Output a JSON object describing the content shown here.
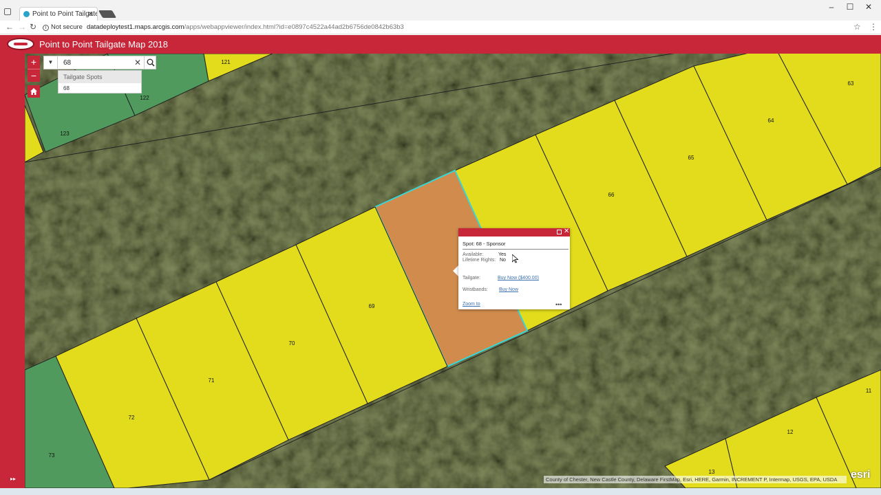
{
  "browser": {
    "tab_title": "Point to Point Tailgate M",
    "security_label": "Not secure",
    "url_host": "datadeploytest1.maps.arcgis.com",
    "url_path": "/apps/webappviewer/index.html?id=e0897c4522a44ad2b6756de0842b63b3"
  },
  "app": {
    "title": "Point to Point Tailgate Map 2018",
    "accent_color": "#c8273a"
  },
  "search": {
    "value": "68",
    "suggestions_header": "Tailgate Spots",
    "suggestions": [
      "68"
    ]
  },
  "map": {
    "parcels": [
      {
        "label": "121",
        "status": "yellow"
      },
      {
        "label": "122",
        "status": "green"
      },
      {
        "label": "123",
        "status": "green"
      },
      {
        "label": "63",
        "status": "yellow"
      },
      {
        "label": "64",
        "status": "yellow"
      },
      {
        "label": "65",
        "status": "yellow"
      },
      {
        "label": "66",
        "status": "yellow"
      },
      {
        "label": "68",
        "status": "selected"
      },
      {
        "label": "69",
        "status": "yellow"
      },
      {
        "label": "70",
        "status": "yellow"
      },
      {
        "label": "71",
        "status": "yellow"
      },
      {
        "label": "72",
        "status": "yellow"
      },
      {
        "label": "73",
        "status": "green"
      },
      {
        "label": "11",
        "status": "yellow"
      },
      {
        "label": "12",
        "status": "yellow"
      },
      {
        "label": "13",
        "status": "yellow"
      }
    ],
    "colors": {
      "available": "#e6e21c",
      "taken": "#4f9a5c",
      "selected": "#d18c4d",
      "highlight": "#38d6d6"
    },
    "attribution": "County of Chester, New Castle County, Delaware FirstMap, Esri, HERE, Garmin, INCREMENT P, Intermap, USGS, EPA, USDA",
    "esri_logo": "esri"
  },
  "popup": {
    "title": "Spot: 68 - Sponsor",
    "available_label": "Available:",
    "available_value": "Yes",
    "lifetime_label": "Lifetime Rights:",
    "lifetime_value": "No",
    "tailgate_label": "Tailgate:",
    "tailgate_link": "Buy Now ($400.00)",
    "wristbands_label": "Wristbands:",
    "wristbands_link": "Buy Now",
    "zoom_link": "Zoom to",
    "more": "•••"
  }
}
